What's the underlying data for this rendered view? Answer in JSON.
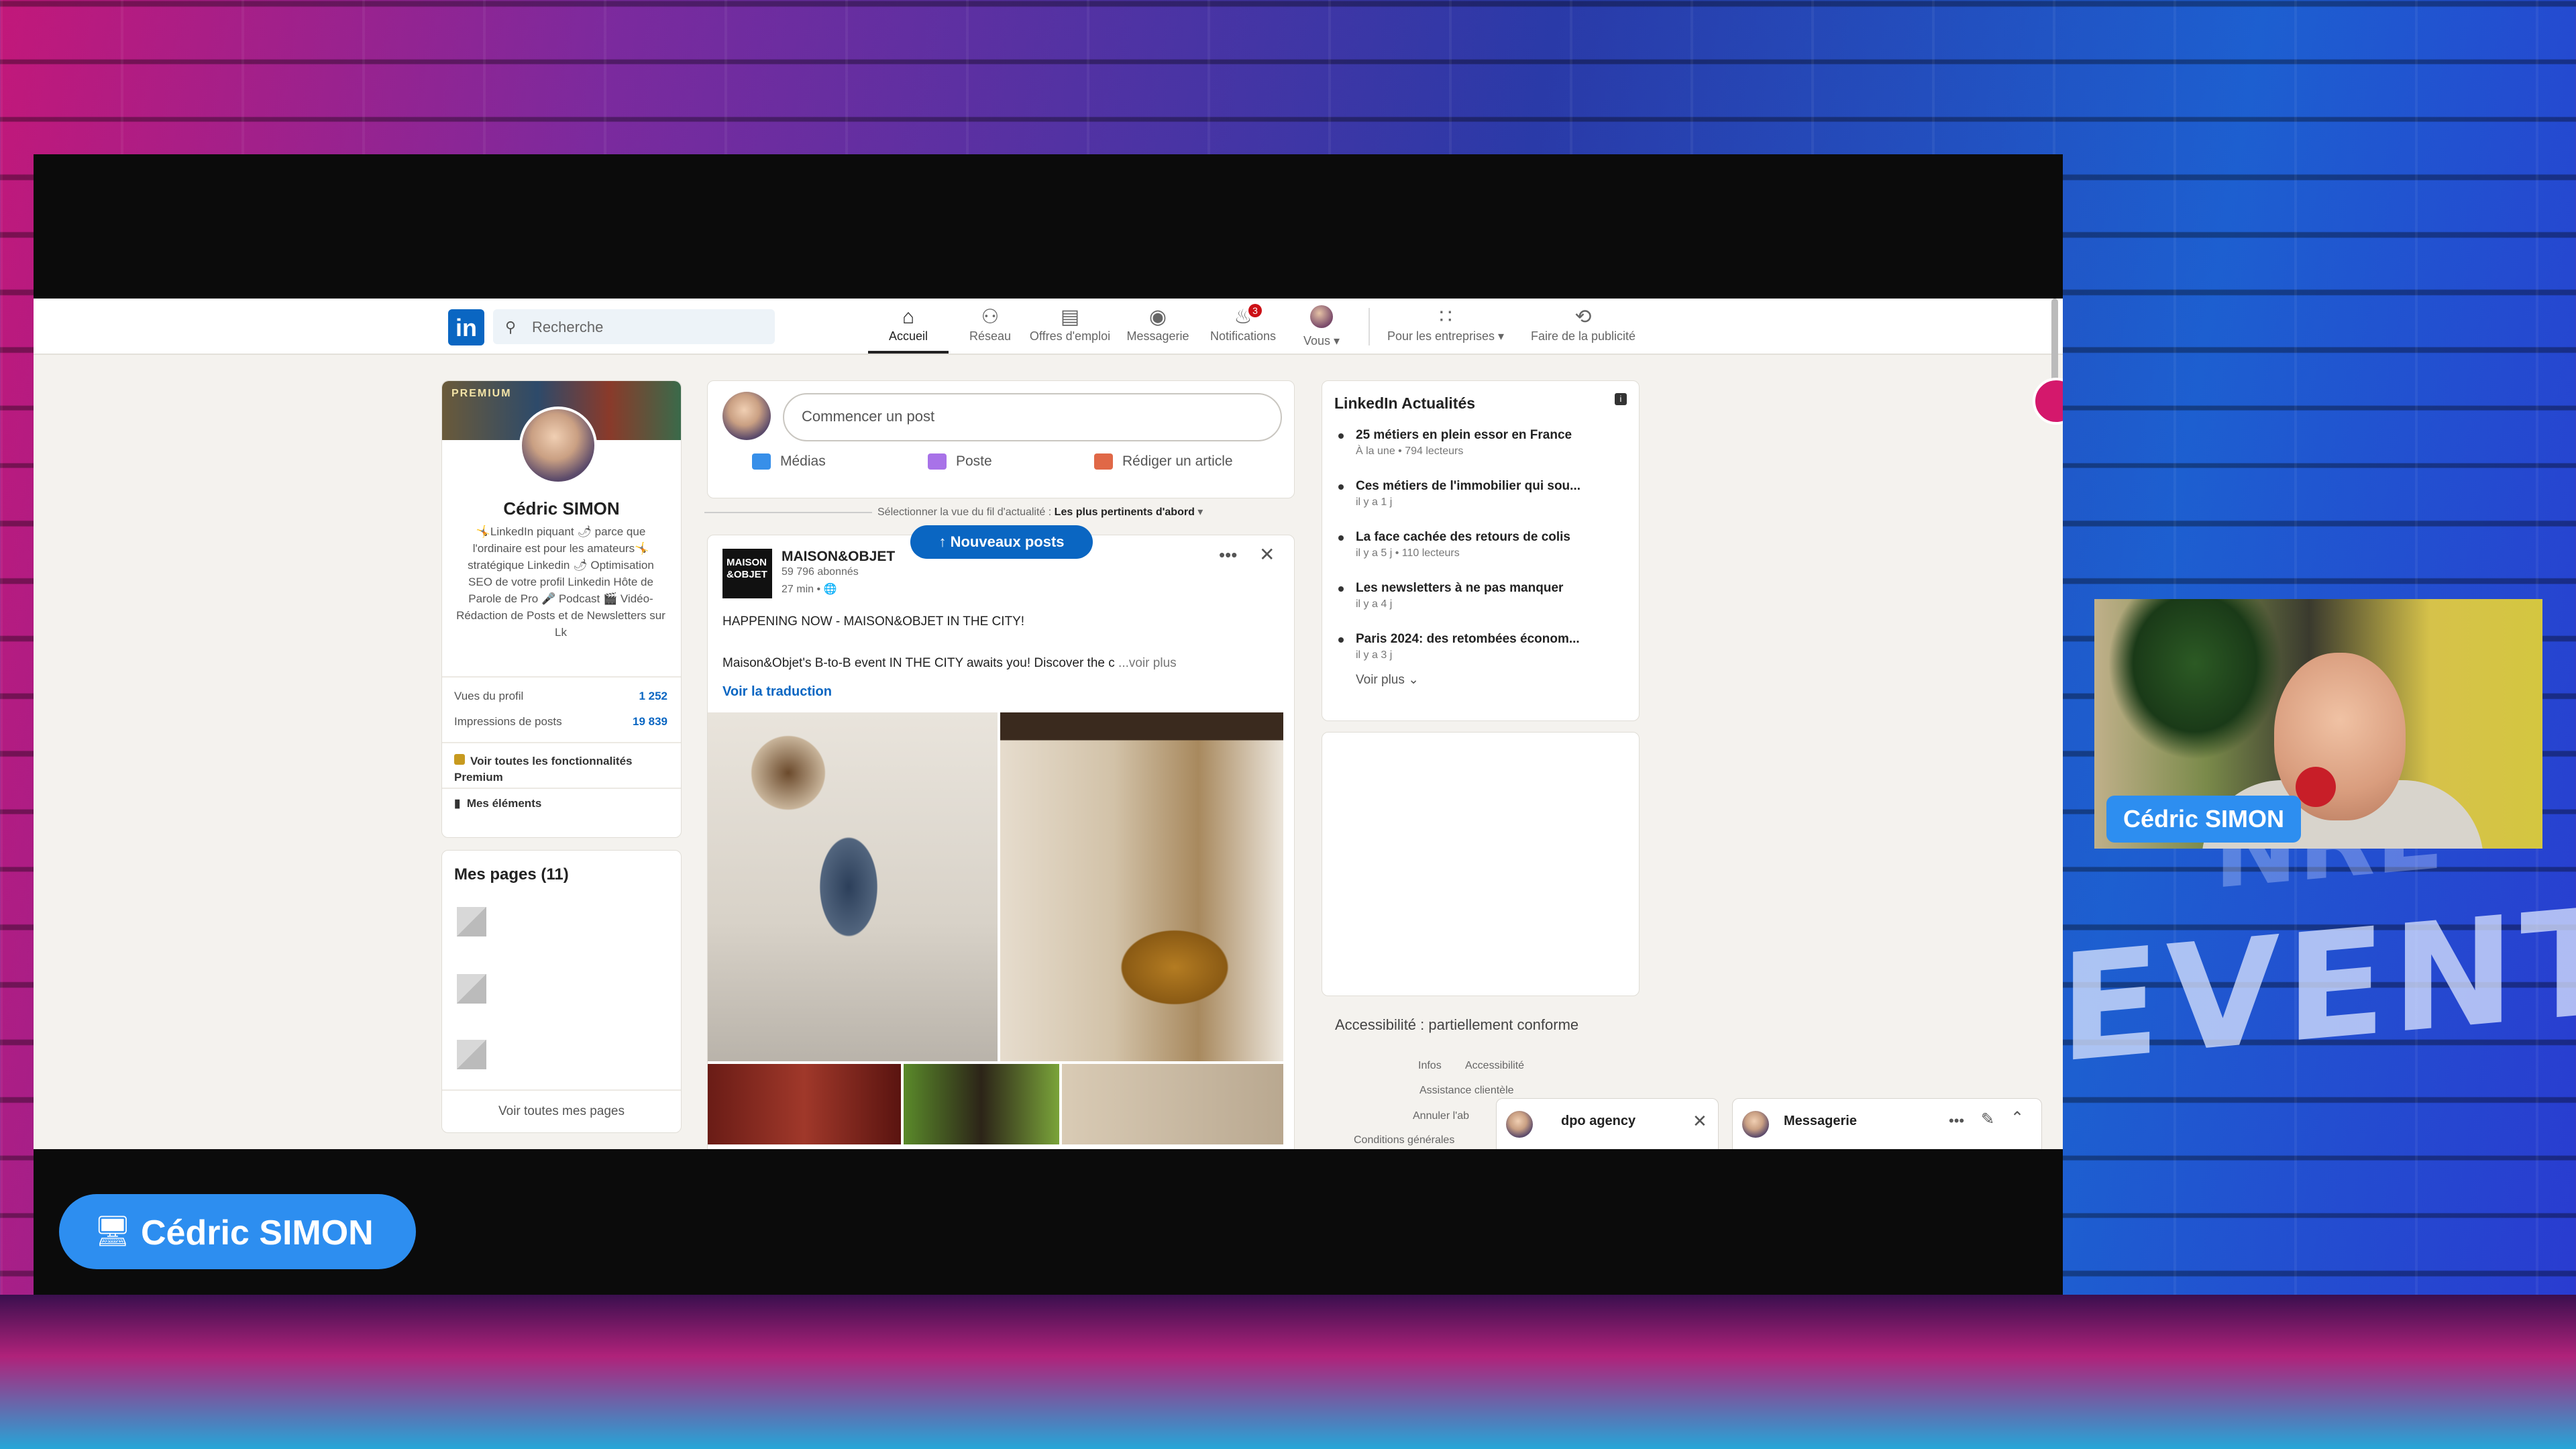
{
  "presenter": {
    "label": "Cédric SIMON",
    "webcam_name": "Cédric SIMON",
    "backdrop_text": "EVENT",
    "backdrop_text_partial": "NRE"
  },
  "linkedin": {
    "search_placeholder": "Recherche",
    "nav": [
      {
        "label": "Accueil",
        "icon": "home-icon",
        "active": true,
        "badge": ""
      },
      {
        "label": "Réseau",
        "icon": "network-icon",
        "badge": ""
      },
      {
        "label": "Offres d'emploi",
        "icon": "briefcase-icon",
        "badge": ""
      },
      {
        "label": "Messagerie",
        "icon": "message-icon",
        "badge": ""
      },
      {
        "label": "Notifications",
        "icon": "bell-icon",
        "badge": "3"
      },
      {
        "label": "Vous",
        "icon": "avatar-icon",
        "badge": ""
      },
      {
        "label": "Pour les entreprises",
        "icon": "grid-icon",
        "badge": ""
      },
      {
        "label": "Faire de la publicité",
        "icon": "ad-icon",
        "badge": ""
      }
    ],
    "profile": {
      "banner": "PREMIUM",
      "name": "Cédric SIMON",
      "bio": "🤸LinkedIn piquant 🌶 parce que l'ordinaire est pour les amateurs🤸 stratégique Linkedin 🌶 Optimisation SEO de votre profil Linkedin Hôte de Parole de Pro 🎤 Podcast 🎬 Vidéo-Rédaction de Posts et de Newsletters sur Lk",
      "views_label": "Vues du profil",
      "views_value": "1 252",
      "impressions_label": "Impressions de posts",
      "impressions_value": "19 839",
      "premium_link": "Voir toutes les fonctionnalités Premium",
      "items_link": "Mes éléments"
    },
    "pages": {
      "title": "Mes pages (11)",
      "see_all": "Voir toutes mes pages"
    },
    "composer": {
      "placeholder": "Commencer un post",
      "media": "Médias",
      "job": "Poste",
      "article": "Rédiger un article"
    },
    "feed_sort": {
      "prefix": "Sélectionner la vue du fil d'actualité :",
      "value": "Les plus pertinents d'abord"
    },
    "new_posts": "↑ Nouveaux posts",
    "post": {
      "logo": "MAISON &OBJET",
      "author": "MAISON&OBJET",
      "followers": "59 796 abonnés",
      "time": "27 min • 🌐",
      "line1": "HAPPENING NOW - MAISON&OBJET IN THE CITY!",
      "line2": "Maison&Objet's B-to-B event IN THE CITY awaits you! Discover the c",
      "more": "...voir plus",
      "translate": "Voir la traduction"
    },
    "news": {
      "title": "LinkedIn Actualités",
      "items": [
        {
          "title": "25 métiers en plein essor en France",
          "sub": "À la une • 794 lecteurs"
        },
        {
          "title": "Ces métiers de l'immobilier qui sou...",
          "sub": "il y a 1 j"
        },
        {
          "title": "La face cachée des retours de colis",
          "sub": "il y a 5 j • 110 lecteurs"
        },
        {
          "title": "Les newsletters à ne pas manquer",
          "sub": "il y a 4 j"
        },
        {
          "title": "Paris 2024: des retombées économ...",
          "sub": "il y a 3 j"
        }
      ],
      "more": "Voir plus"
    },
    "accessibility": "Accessibilité : partiellement conforme",
    "footer": {
      "infos": "Infos",
      "accessibility": "Accessibilité",
      "assistance": "Assistance clientèle",
      "cancel": "Annuler l'ab",
      "conditions": "Conditions générales"
    },
    "chat_pills": {
      "dpo": "dpo agency",
      "messaging": "Messagerie"
    }
  }
}
